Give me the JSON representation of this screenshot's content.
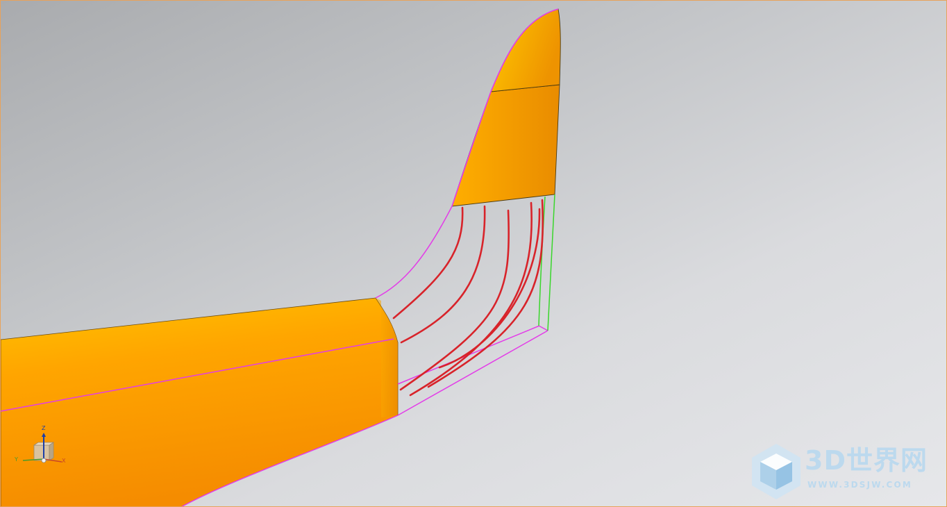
{
  "colors": {
    "surface_orange_light": "#ffc400",
    "surface_orange_mid": "#ffa000",
    "surface_orange_dark": "#e88a00",
    "boundary_magenta": "#e33ce8",
    "section_curve_red": "#d8232a",
    "guide_line_green": "#39d62b",
    "viewport_border": "#e8a25a",
    "watermark_blue": "#bcd9ee"
  },
  "triad": {
    "z_label": "Z",
    "x_label": "X",
    "y_label": "Y"
  },
  "watermark": {
    "title": "3D世界网",
    "url": "WWW.3DSJW.COM"
  }
}
